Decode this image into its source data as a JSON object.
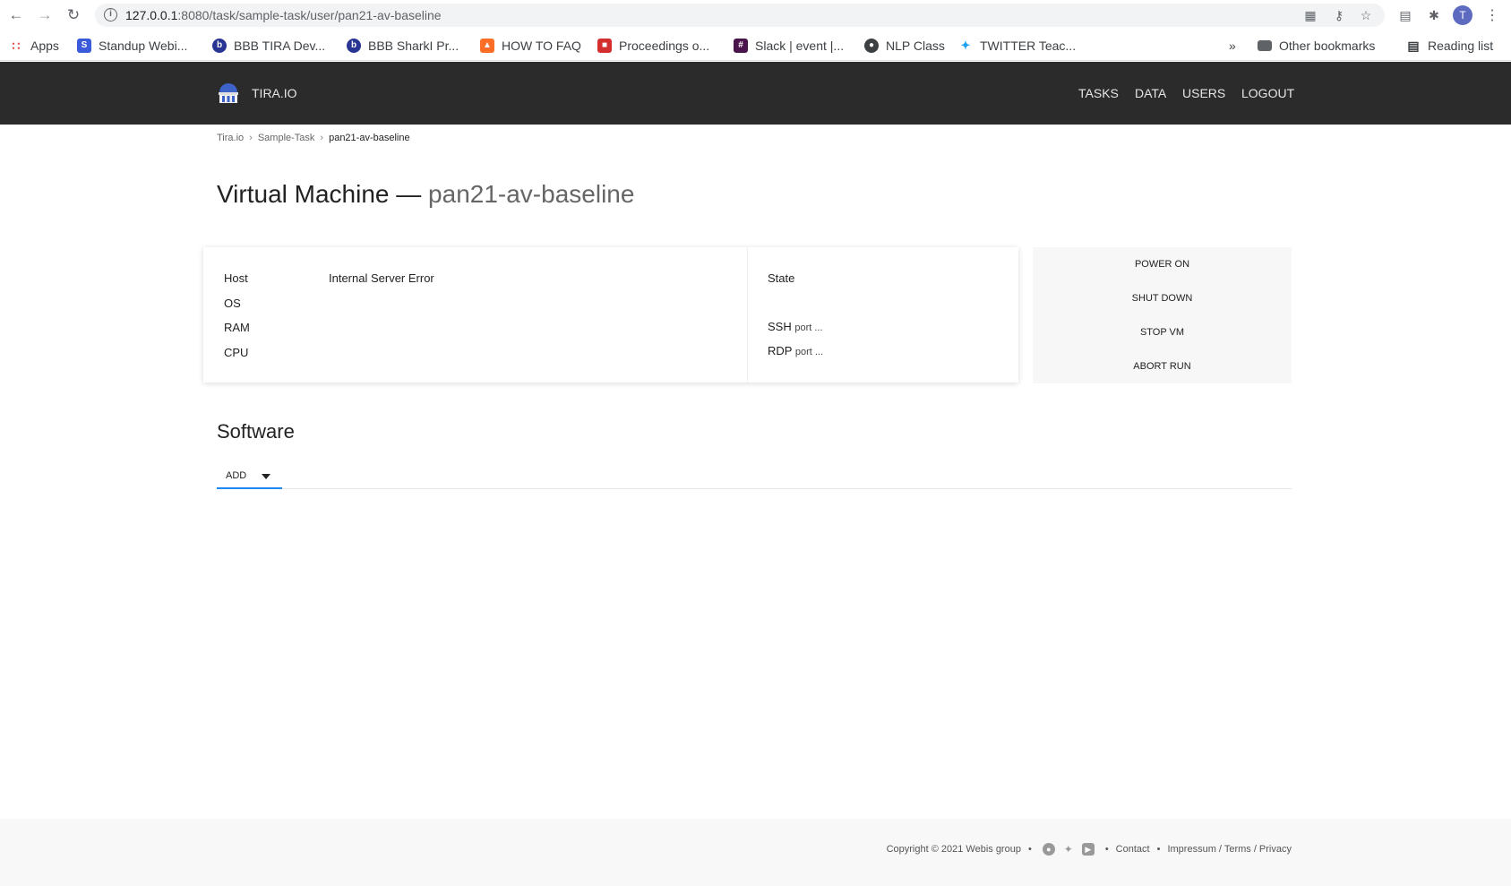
{
  "browser": {
    "url_host": "127.0.0.1",
    "url_rest": ":8080/task/sample-task/user/pan21-av-baseline",
    "profile_initial": "T",
    "bookmarks": [
      {
        "label": "Apps",
        "icon": "apps-grid-icon",
        "color": "#e8453c"
      },
      {
        "label": "Standup Webi...",
        "icon": "standup-icon",
        "color": "#3b5bdb"
      },
      {
        "label": "BBB TIRA Dev...",
        "icon": "bbb-icon",
        "color": "#283593"
      },
      {
        "label": "BBB SharkI Pr...",
        "icon": "bbb-icon",
        "color": "#283593"
      },
      {
        "label": "HOW TO FAQ",
        "icon": "gitlab-icon",
        "color": "#fc6d26"
      },
      {
        "label": "Proceedings o...",
        "icon": "proceedings-icon",
        "color": "#d32f2f"
      },
      {
        "label": "Slack | event |...",
        "icon": "slack-icon",
        "color": "#4a154b"
      },
      {
        "label": "NLP Class",
        "icon": "globe-icon",
        "color": "#3c4043"
      },
      {
        "label": "TWITTER Teac...",
        "icon": "twitter-icon",
        "color": "#1da1f2"
      }
    ],
    "overflow": "»",
    "other_bookmarks": "Other bookmarks",
    "reading_list": "Reading list"
  },
  "header": {
    "brand": "TIRA.IO",
    "nav": [
      "TASKS",
      "DATA",
      "USERS",
      "LOGOUT"
    ]
  },
  "breadcrumb": [
    "Tira.io",
    "Sample-Task",
    "pan21-av-baseline"
  ],
  "page": {
    "title_prefix": "Virtual Machine —",
    "title_vm": "pan21-av-baseline"
  },
  "vm_info": {
    "host_label": "Host",
    "host_value": "Internal Server Error",
    "os_label": "OS",
    "ram_label": "RAM",
    "cpu_label": "CPU",
    "state_label": "State",
    "ssh_label": "SSH",
    "ssh_port": "port ...",
    "rdp_label": "RDP",
    "rdp_port": "port ..."
  },
  "actions": [
    "POWER ON",
    "SHUT DOWN",
    "STOP VM",
    "ABORT RUN"
  ],
  "software": {
    "title": "Software",
    "add_label": "ADD"
  },
  "footer": {
    "copyright": "Copyright © 2021 Webis group",
    "contact": "Contact",
    "legal": "Impressum / Terms / Privacy"
  }
}
